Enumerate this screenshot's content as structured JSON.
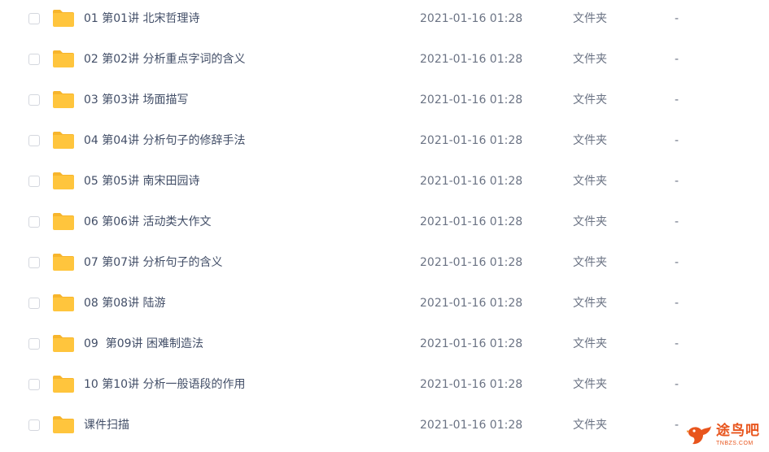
{
  "file_list": {
    "rows": [
      {
        "name": "01 第01讲 北宋哲理诗",
        "date": "2021-01-16 01:28",
        "type": "文件夹",
        "size": "-"
      },
      {
        "name": "02 第02讲 分析重点字词的含义",
        "date": "2021-01-16 01:28",
        "type": "文件夹",
        "size": "-"
      },
      {
        "name": "03 第03讲 场面描写",
        "date": "2021-01-16 01:28",
        "type": "文件夹",
        "size": "-"
      },
      {
        "name": "04 第04讲 分析句子的修辞手法",
        "date": "2021-01-16 01:28",
        "type": "文件夹",
        "size": "-"
      },
      {
        "name": "05 第05讲 南宋田园诗",
        "date": "2021-01-16 01:28",
        "type": "文件夹",
        "size": "-"
      },
      {
        "name": "06 第06讲 活动类大作文",
        "date": "2021-01-16 01:28",
        "type": "文件夹",
        "size": "-"
      },
      {
        "name": "07 第07讲 分析句子的含义",
        "date": "2021-01-16 01:28",
        "type": "文件夹",
        "size": "-"
      },
      {
        "name": "08 第08讲 陆游",
        "date": "2021-01-16 01:28",
        "type": "文件夹",
        "size": "-"
      },
      {
        "name": "09  第09讲 困难制造法",
        "date": "2021-01-16 01:28",
        "type": "文件夹",
        "size": "-"
      },
      {
        "name": "10 第10讲 分析一般语段的作用",
        "date": "2021-01-16 01:28",
        "type": "文件夹",
        "size": "-"
      },
      {
        "name": "课件扫描",
        "date": "2021-01-16 01:28",
        "type": "文件夹",
        "size": "-"
      }
    ]
  },
  "watermark": {
    "brand": "途鸟吧",
    "domain": "TNBZS.COM",
    "icon": "bird-logo-icon"
  },
  "colors": {
    "folder": "#ffc53d",
    "folder_tab": "#f7b52c",
    "text": "#424e67",
    "muted": "#6b7384",
    "checkbox_border": "#d4d7de",
    "watermark": "#e8551d"
  }
}
